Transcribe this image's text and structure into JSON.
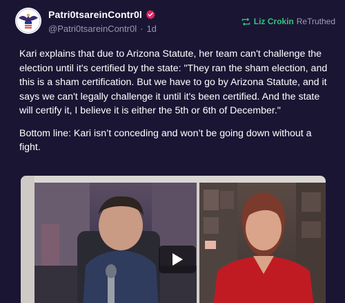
{
  "author": {
    "display_name": "Patri0tsareinContr0l",
    "handle": "@Patri0tsareinContr0l",
    "separator": "·",
    "age": "1d",
    "avatar_icon": "eagle-emblem-icon",
    "verified_icon": "verified-badge-icon"
  },
  "retruth": {
    "icon": "retruth-icon",
    "user": "Liz Crokin",
    "label": "ReTruthed"
  },
  "post": {
    "paragraph_1": "Kari explains that due to Arizona Statute, her team can't challenge the election until it's certified by the state: \"They ran the sham election, and this is a sham certification. But we have to go by Arizona Statute, and it says we can't legally challenge it until it's been certified. And the state will certify it, I believe it is either the 5th or 6th of December.\"",
    "paragraph_2": "Bottom line: Kari isn’t conceding and won’t be going down without a fight."
  },
  "video": {
    "play_icon": "play-icon"
  },
  "colors": {
    "background": "#1b1534",
    "accent_green": "#36c27e",
    "verified_red": "#e0245e",
    "muted_text": "#9b96b3"
  }
}
